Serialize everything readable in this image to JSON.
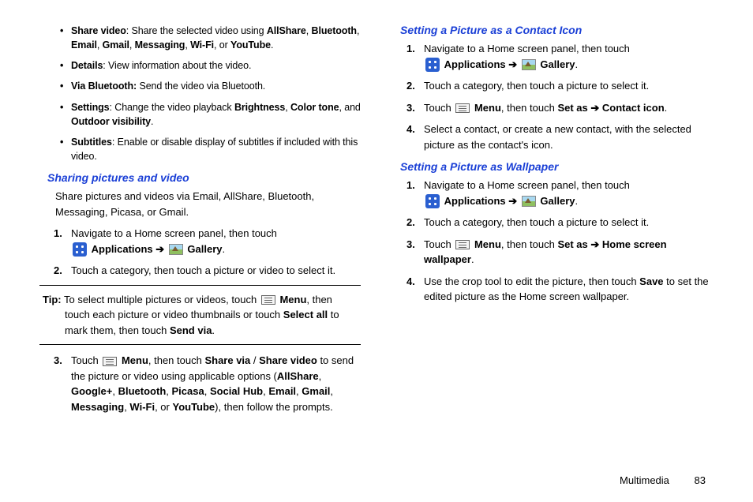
{
  "col1": {
    "bullets": [
      {
        "label": "Share video",
        "rest_a": ": Share the selected video using ",
        "bolds": [
          "AllShare",
          "Bluetooth",
          "Email",
          "Gmail",
          "Messaging",
          "Wi-Fi",
          "YouTube"
        ],
        "rest_b": "."
      },
      {
        "label": "Details",
        "rest": ": View information about the video."
      },
      {
        "label": "Via Bluetooth:",
        "rest": " Send the video via Bluetooth."
      },
      {
        "label": "Settings",
        "rest_a": ": Change the video playback ",
        "bolds": [
          "Brightness",
          "Color tone"
        ],
        "rest_mid": ", and ",
        "bold_end": "Outdoor visibility",
        "rest_b": "."
      },
      {
        "label": "Subtitles",
        "rest": ": Enable or disable display of subtitles if included with this video."
      }
    ],
    "heading1": "Sharing pictures and video",
    "intro1": "Share pictures and videos via Email, AllShare, Bluetooth, Messaging, Picasa, or Gmail.",
    "steps_a": {
      "s1": "Navigate to a Home screen panel, then touch",
      "applications": "Applications",
      "gallery": "Gallery",
      "s2": "Touch a category, then touch a picture or video to select it."
    },
    "tip": {
      "label": "Tip:",
      "a": " To select multiple pictures or videos, touch ",
      "menu": "Menu",
      "b": ", then touch each picture or video thumbnails or touch ",
      "selectall": "Select all",
      "c": " to mark them, then touch ",
      "sendvia": "Send via",
      "d": "."
    },
    "steps_b": {
      "s3_a": "Touch ",
      "menu": "Menu",
      "s3_b": ", then touch ",
      "sharevia": "Share via",
      "slash": " / ",
      "sharevideo": "Share video",
      "s3_c": " to send the picture or video using applicable options (",
      "opts": [
        "AllShare",
        "Google+",
        "Bluetooth",
        "Picasa",
        "Social Hub",
        "Email",
        "Gmail",
        "Messaging",
        "Wi-Fi",
        "YouTube"
      ],
      "s3_d": "), then follow the prompts."
    }
  },
  "col2": {
    "heading2": "Setting a Picture as a Contact Icon",
    "sec2": {
      "s1": "Navigate to a Home screen panel, then touch",
      "applications": "Applications",
      "gallery": "Gallery",
      "s2": "Touch a category, then touch a picture to select it.",
      "s3_a": "Touch ",
      "menu": "Menu",
      "s3_b": ", then touch ",
      "setas": "Set as",
      "s3_c": " ➔ ",
      "contacticon": "Contact icon",
      "s3_d": ".",
      "s4": "Select a contact, or create a new contact, with the selected picture as the contact's icon."
    },
    "heading3": "Setting a Picture as Wallpaper",
    "sec3": {
      "s1": "Navigate to a Home screen panel, then touch",
      "applications": "Applications",
      "gallery": "Gallery",
      "s2": "Touch a category, then touch a picture to select it.",
      "s3_a": "Touch ",
      "menu": "Menu",
      "s3_b": ", then touch ",
      "setas": "Set as",
      "s3_c": " ➔ ",
      "hsw": "Home screen wallpaper",
      "s3_d": ".",
      "s4_a": "Use the crop tool to edit the picture, then touch ",
      "save": "Save",
      "s4_b": " to set the edited picture as the Home screen wallpaper."
    }
  },
  "footer": {
    "section": "Multimedia",
    "page": "83"
  }
}
